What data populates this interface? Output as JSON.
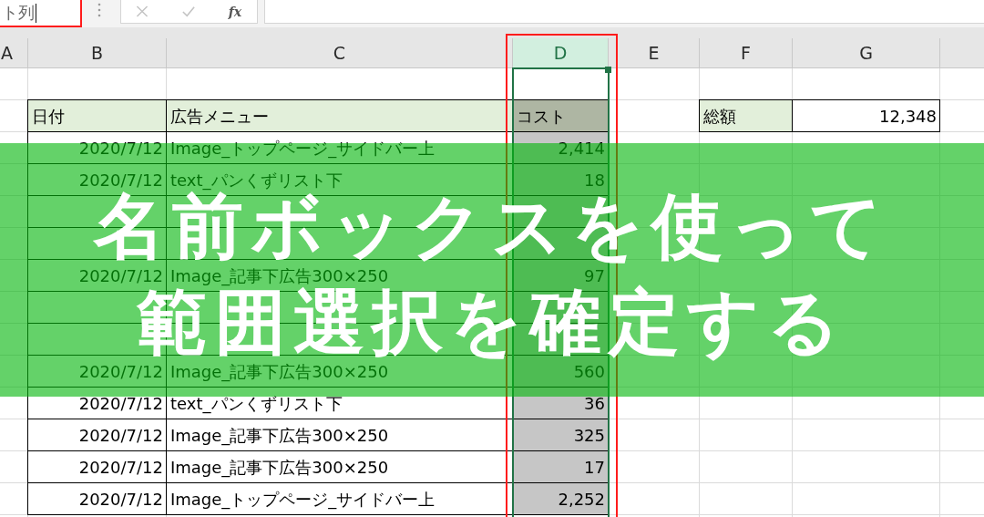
{
  "formula_bar": {
    "name_box": {
      "value": "ト列",
      "highlighted": true,
      "focused": true
    },
    "buttons": [
      {
        "kind": "cancel",
        "disabled": true
      },
      {
        "kind": "enter",
        "disabled": true
      },
      {
        "kind": "function",
        "label": "fx",
        "disabled": false
      }
    ]
  },
  "columns": [
    {
      "label": "A",
      "selected": false,
      "highlighted": false
    },
    {
      "label": "B",
      "selected": false,
      "highlighted": false
    },
    {
      "label": "C",
      "selected": false,
      "highlighted": false
    },
    {
      "label": "D",
      "selected": true,
      "highlighted": true
    },
    {
      "label": "E",
      "selected": false,
      "highlighted": false
    },
    {
      "label": "F",
      "selected": false,
      "highlighted": false
    },
    {
      "label": "G",
      "selected": false,
      "highlighted": false
    }
  ],
  "table": {
    "headers": [
      "日付",
      "広告メニュー",
      "コスト"
    ],
    "rows": [
      {
        "date": "2020/7/12",
        "menu": "Image_トップページ_サイドバー上",
        "cost": "2,414"
      },
      {
        "date": "2020/7/12",
        "menu": "text_パンくずリスト下",
        "cost": "18"
      },
      {},
      {},
      {
        "date": "2020/7/12",
        "menu": "Image_記事下広告300×250",
        "cost": "97"
      },
      {},
      {},
      {
        "date": "2020/7/12",
        "menu": "Image_記事下広告300×250",
        "cost": "560"
      },
      {
        "date": "2020/7/12",
        "menu": "text_パンくずリスト下",
        "cost": "36"
      },
      {
        "date": "2020/7/12",
        "menu": "Image_記事下広告300×250",
        "cost": "325"
      },
      {
        "date": "2020/7/12",
        "menu": "Image_記事下広告300×250",
        "cost": "17"
      },
      {
        "date": "2020/7/12",
        "menu": "Image_トップページ_サイドバー上",
        "cost": "2,252"
      }
    ]
  },
  "summary": {
    "label": "総額",
    "value": "12,348"
  },
  "banner": {
    "lines": [
      "名前ボックスを使って",
      "範囲選択を確定する"
    ]
  }
}
